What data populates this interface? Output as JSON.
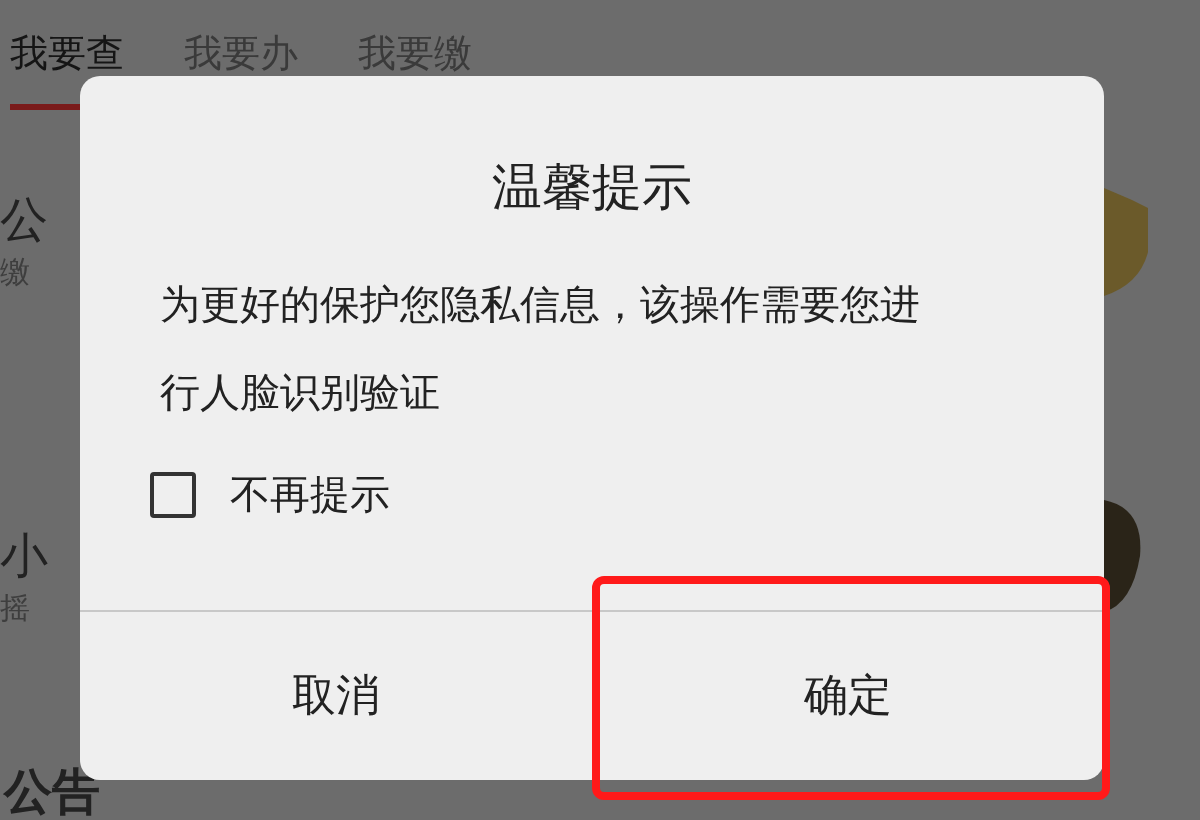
{
  "tabs": [
    {
      "label": "我要查",
      "selected": true
    },
    {
      "label": "我要办",
      "selected": false
    },
    {
      "label": "我要缴",
      "selected": false
    }
  ],
  "items": [
    {
      "title": "公",
      "subtitle": "缴"
    },
    {
      "title": "小",
      "subtitle": "摇"
    }
  ],
  "notice_label": "公告",
  "dialog": {
    "title": "温馨提示",
    "message": "为更好的保护您隐私信息，该操作需要您进行人脸识别验证",
    "checkbox": {
      "label": "不再提示",
      "checked": false
    },
    "buttons": [
      {
        "label": "取消",
        "highlighted": false
      },
      {
        "label": "确定",
        "highlighted": true
      }
    ]
  }
}
